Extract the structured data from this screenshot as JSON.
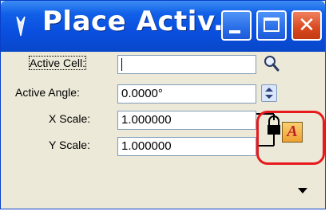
{
  "window": {
    "title": "Place Activ...",
    "buttons": {
      "minimize": "minimize",
      "maximize": "maximize",
      "close": "✕"
    }
  },
  "form": {
    "active_cell": {
      "label": "Active Cell:",
      "value": ""
    },
    "active_angle": {
      "label": "Active Angle:",
      "value": "0.0000°"
    },
    "x_scale": {
      "label": "X Scale:",
      "value": "1.000000"
    },
    "y_scale": {
      "label": "Y Scale:",
      "value": "1.000000"
    }
  },
  "icons": {
    "browse_cell": "magnifier-icon",
    "angle_spinner": "spin-arrows-icon",
    "scale_lock": "lock-icon",
    "scale_tool": "scale-A-icon",
    "options": "dropdown-triangle-icon"
  },
  "colors": {
    "titlebar": "#0a4fe0",
    "highlight": "#e8191c",
    "panel": "#ece9d8"
  }
}
